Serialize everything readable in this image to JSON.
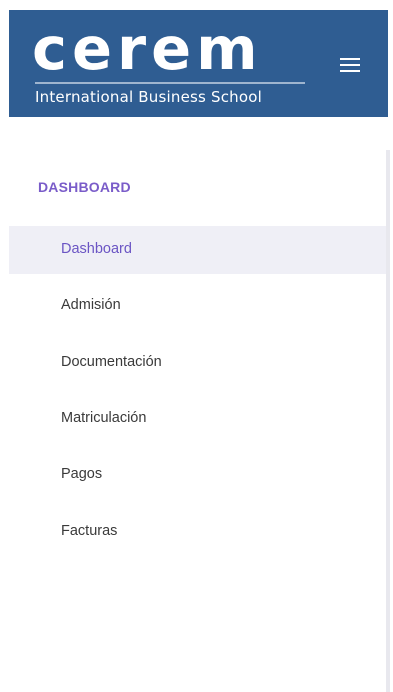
{
  "header": {
    "logo_text": "cerem",
    "logo_subtitle": "International Business School",
    "menu_icon": "hamburger-menu-icon"
  },
  "sidebar": {
    "section_title": "DASHBOARD",
    "items": [
      {
        "label": "Dashboard",
        "active": true
      },
      {
        "label": "Admisión",
        "active": false
      },
      {
        "label": "Documentación",
        "active": false
      },
      {
        "label": "Matriculación",
        "active": false
      },
      {
        "label": "Pagos",
        "active": false
      },
      {
        "label": "Facturas",
        "active": false
      }
    ]
  },
  "colors": {
    "header_bg": "#2f5d92",
    "accent": "#7a5cc9",
    "active_bg": "#efeff6"
  }
}
